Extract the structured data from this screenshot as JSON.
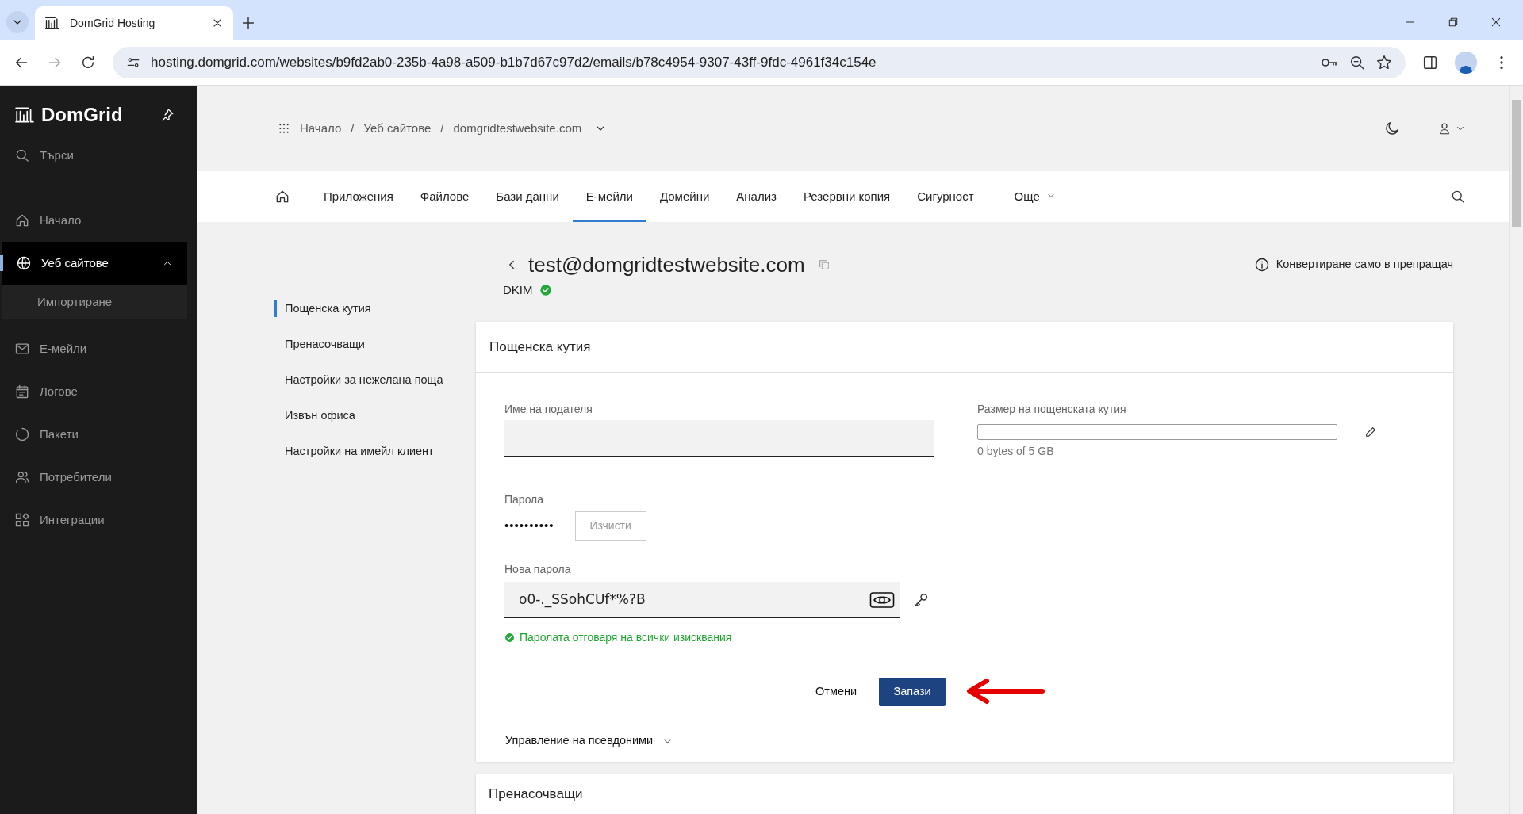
{
  "browser": {
    "tab_title": "DomGrid Hosting",
    "url": "hosting.domgrid.com/websites/b9fd2ab0-235b-4a98-a509-b1b7d67c97d2/emails/b78c4954-9307-43ff-9fdc-4961f34c154e"
  },
  "sidebar": {
    "logo": "DomGrid",
    "search": "Търси",
    "items": [
      {
        "label": "Начало",
        "selected": false
      },
      {
        "label": "Уеб сайтове",
        "selected": true,
        "expanded": true,
        "children": [
          {
            "label": "Импортиране"
          }
        ]
      },
      {
        "label": "Е-мейли",
        "selected": false
      },
      {
        "label": "Логове",
        "selected": false
      },
      {
        "label": "Пакети",
        "selected": false
      },
      {
        "label": "Потребители",
        "selected": false
      },
      {
        "label": "Интеграции",
        "selected": false
      }
    ]
  },
  "breadcrumb": [
    {
      "label": "Начало",
      "separator": "/"
    },
    {
      "label": "Уеб сайтове",
      "separator": "/"
    },
    {
      "label": "domgridtestwebsite.com"
    }
  ],
  "nav": {
    "tabs": [
      {
        "label": "Приложения",
        "selected": false
      },
      {
        "label": "Файлове",
        "selected": false
      },
      {
        "label": "Бази данни",
        "selected": false
      },
      {
        "label": "Е-мейли",
        "selected": true
      },
      {
        "label": "Домейни",
        "selected": false
      },
      {
        "label": "Анализ",
        "selected": false
      },
      {
        "label": "Резервни копия",
        "selected": false
      },
      {
        "label": "Сигурност",
        "selected": false
      },
      {
        "label": "Още",
        "selected": false
      }
    ]
  },
  "email": {
    "address": "test@domgridtestwebsite.com",
    "dkim": "DKIM",
    "convert_link": "Конвертиране само в препращач"
  },
  "subnav": [
    {
      "label": "Пощенска кутия",
      "selected": true
    },
    {
      "label": "Пренасочващи",
      "selected": false
    },
    {
      "label": "Настройки за нежелана поща",
      "selected": false
    },
    {
      "label": "Извън офиса",
      "selected": false
    },
    {
      "label": "Настройки на имейл клиент",
      "selected": false
    }
  ],
  "mailbox_card": {
    "title": "Пощенска кутия",
    "sender_name": {
      "label": "Име на подателя"
    },
    "mailbox_size": {
      "label": "Размер на пощенската кутия",
      "level": 0,
      "reading": "0 bytes of 5 GB"
    },
    "password": {
      "label": "Парола",
      "masked": "••••••••••",
      "clear_button": "Изчисти"
    },
    "new_password": {
      "label": "Нова парола",
      "value": "o0-._SSohCUf*%?B",
      "valid": true,
      "message": "Паролата отговаря на всички изисквания"
    },
    "cancel": "Отмени",
    "save": "Запази",
    "aliases": "Управление на псевдоними"
  },
  "forwarders_card": {
    "title": "Пренасочващи"
  }
}
